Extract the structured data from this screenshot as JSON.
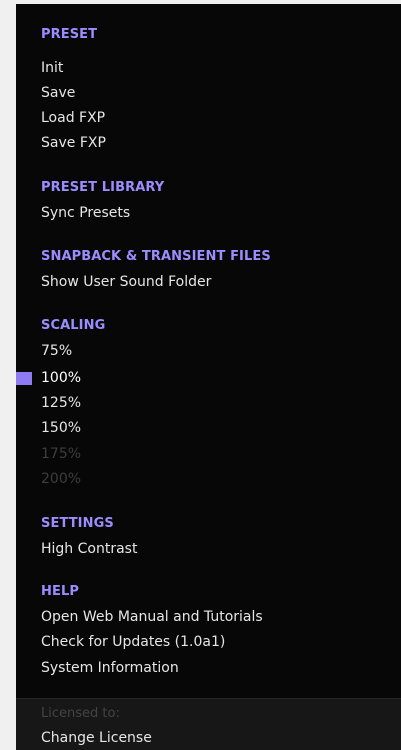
{
  "colors": {
    "menu_background": "#070707",
    "footer_background": "#171717",
    "section_title": "#9d8cff",
    "item_text": "#e6e6e6",
    "disabled_text": "#3d3d3d",
    "selection_marker": "#8f7cf3"
  },
  "menu": {
    "preset": {
      "title": "PRESET",
      "items": [
        "Init",
        "Save",
        "Load FXP",
        "Save FXP"
      ]
    },
    "preset_library": {
      "title": "PRESET LIBRARY",
      "items": [
        "Sync Presets"
      ]
    },
    "snapback": {
      "title": "SNAPBACK & TRANSIENT FILES",
      "items": [
        "Show User Sound Folder"
      ]
    },
    "scaling": {
      "title": "SCALING",
      "items": [
        "75%",
        "100%",
        "125%",
        "150%",
        "175%",
        "200%"
      ],
      "selected": "100%",
      "disabled": [
        "175%",
        "200%"
      ]
    },
    "settings": {
      "title": "SETTINGS",
      "items": [
        "High Contrast"
      ]
    },
    "help": {
      "title": "HELP",
      "items": [
        "Open Web Manual and Tutorials",
        "Check for Updates (1.0a1)",
        "System Information"
      ]
    }
  },
  "footer": {
    "licensed_label": "Licensed to:",
    "change_license_label": "Change License"
  }
}
